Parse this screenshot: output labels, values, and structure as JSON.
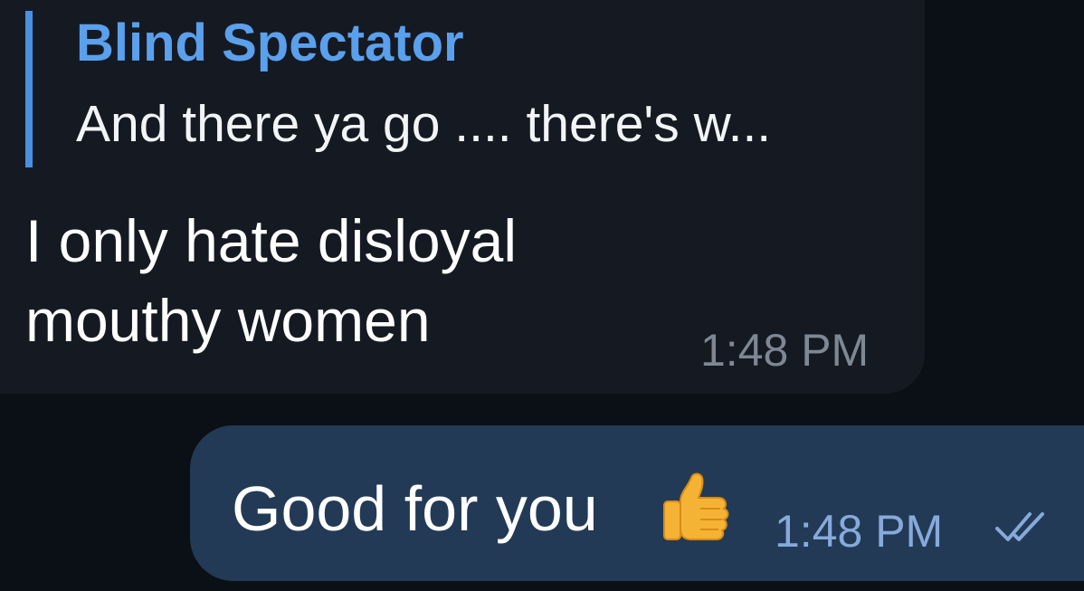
{
  "incoming": {
    "reply": {
      "author": "Blind Spectator",
      "snippet": "And there ya go .... there's w..."
    },
    "text_line1": "I only hate disloyal",
    "text_line2": "mouthy women",
    "time": "1:48 PM"
  },
  "outgoing": {
    "text": "Good for you",
    "emoji_icon": "thumbs-up-icon",
    "time": "1:48 PM",
    "status_icon": "double-check-icon"
  },
  "colors": {
    "background": "#0b0f16",
    "incoming_bubble": "#151a22",
    "outgoing_bubble": "#233a56",
    "accent": "#5aa0ec"
  }
}
